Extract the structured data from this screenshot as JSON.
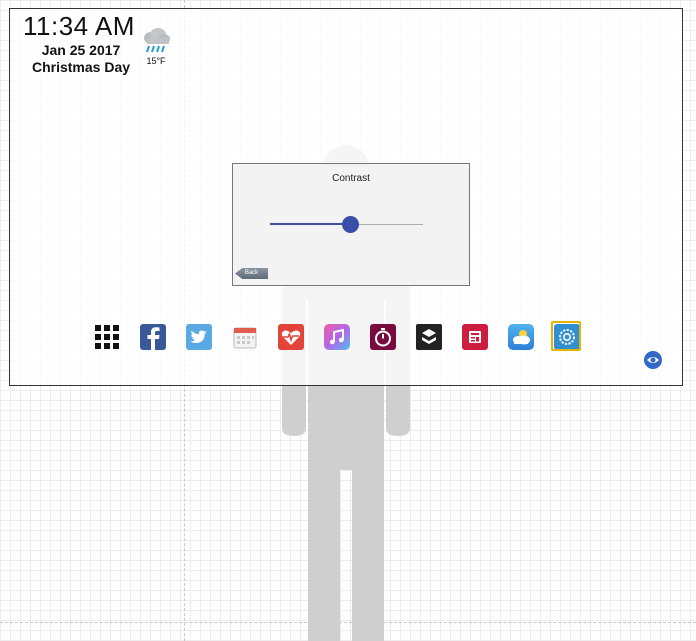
{
  "clock": {
    "time": "11:34 AM"
  },
  "date": {
    "line1": "Jan 25 2017",
    "line2": "Christmas Day"
  },
  "weather": {
    "icon": "rain-cloud-icon",
    "temperature": "15°F"
  },
  "contrast_panel": {
    "title": "Contrast",
    "value": 0.52,
    "back_label": "Back"
  },
  "dock": {
    "apps": [
      {
        "name": "apps-grid-icon"
      },
      {
        "name": "facebook-icon"
      },
      {
        "name": "twitter-icon"
      },
      {
        "name": "calendar-icon"
      },
      {
        "name": "health-icon"
      },
      {
        "name": "music-icon"
      },
      {
        "name": "timer-icon"
      },
      {
        "name": "500px-icon"
      },
      {
        "name": "news-icon"
      },
      {
        "name": "weather-icon"
      },
      {
        "name": "settings-icon",
        "selected": true
      }
    ]
  },
  "colors": {
    "accent": "#3b4ea7",
    "selected_outline": "#e6b400",
    "frame": "#333333"
  }
}
